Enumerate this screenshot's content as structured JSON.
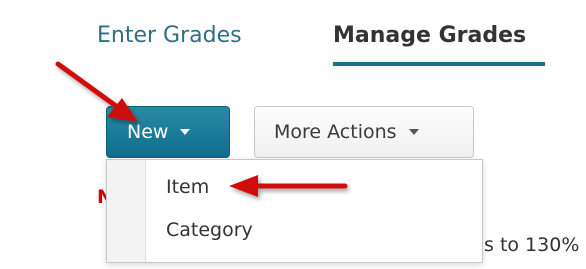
{
  "tabs": [
    {
      "label": "Enter Grades",
      "active": false
    },
    {
      "label": "Manage Grades",
      "active": true
    }
  ],
  "toolbar": {
    "new_label": "New",
    "more_actions_label": "More Actions"
  },
  "dropdown": {
    "items": [
      {
        "label": "Item"
      },
      {
        "label": "Category"
      }
    ]
  },
  "background": {
    "red_fragment": "N",
    "partial_text": "s to 130%"
  },
  "annotations": {
    "arrow_color": "#d01010"
  },
  "colors": {
    "accent": "#1a6e87",
    "tab_link": "#2e6f87"
  }
}
